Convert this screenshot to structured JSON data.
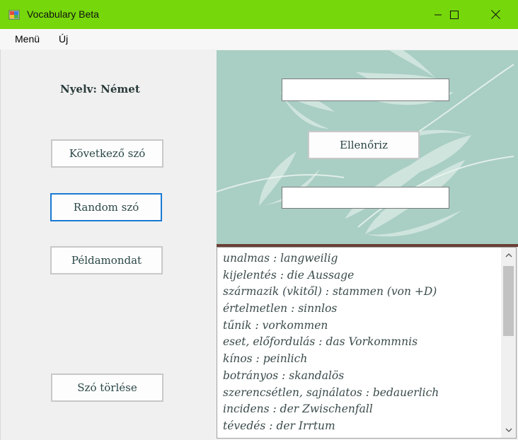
{
  "window": {
    "title": "Vocabulary Beta",
    "titlebar_color": "#76d70b"
  },
  "menu": {
    "items": [
      "Menü",
      "Új"
    ]
  },
  "left": {
    "language_label": "Nyelv: Német",
    "next_word_button": "Következő szó",
    "random_word_button": "Random szó",
    "example_sentence_button": "Példamondat",
    "delete_word_button": "Szó törlése"
  },
  "right": {
    "check_button": "Ellenőriz",
    "input_top_value": "",
    "input_bottom_value": "",
    "background_color": "#a9cec4"
  },
  "word_list": [
    "unalmas : langweilig",
    "kijelentés : die Aussage",
    "származik (vkitől) : stammen (von +D)",
    "értelmetlen : sinnlos",
    "tűnik : vorkommen",
    "eset, előfordulás : das Vorkommnis",
    "kínos : peinlich",
    "botrányos : skandalös",
    "szerencsétlen, sajnálatos : bedauerlich",
    "incidens : der Zwischenfall",
    "tévedés : der Irrtum"
  ]
}
